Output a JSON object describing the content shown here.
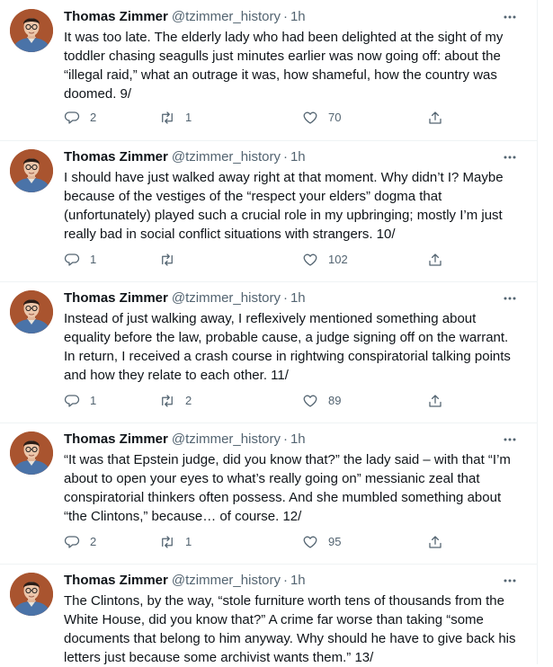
{
  "colors": {
    "text": "#0f1419",
    "secondary": "#536471",
    "divider": "#eff3f4",
    "avatar_bg": "#a9542f"
  },
  "icons": {
    "reply": "reply-icon",
    "retweet": "retweet-icon",
    "like": "like-icon",
    "share": "share-icon",
    "more": "more-options-icon"
  },
  "tweets": [
    {
      "name": "Thomas Zimmer",
      "handle": "@tzimmer_history",
      "separator": "·",
      "time": "1h",
      "text": "It was too late. The elderly lady who had been delighted at the sight of my toddler chasing seagulls just minutes earlier was now going off: about the “illegal raid,” what an outrage it was, how shameful, how the country was doomed. 9/",
      "replies": "2",
      "retweets": "1",
      "likes": "70"
    },
    {
      "name": "Thomas Zimmer",
      "handle": "@tzimmer_history",
      "separator": "·",
      "time": "1h",
      "text": "I should have just walked away right at that moment. Why didn’t I? Maybe because of the vestiges of the “respect your elders” dogma that (unfortunately) played such a crucial role in my upbringing; mostly I’m just really bad in social conflict situations with strangers. 10/",
      "replies": "1",
      "retweets": "",
      "likes": "102"
    },
    {
      "name": "Thomas Zimmer",
      "handle": "@tzimmer_history",
      "separator": "·",
      "time": "1h",
      "text": "Instead of just walking away, I reflexively mentioned something about equality before the law, probable cause, a judge signing off on the warrant. In return, I received a crash course in rightwing conspiratorial talking points and how they relate to each other. 11/",
      "replies": "1",
      "retweets": "2",
      "likes": "89"
    },
    {
      "name": "Thomas Zimmer",
      "handle": "@tzimmer_history",
      "separator": "·",
      "time": "1h",
      "text": "“It was that Epstein judge, did you know that?” the lady said – with that “I’m about to open your eyes to what’s really going on” messianic zeal that conspiratorial thinkers often possess. And she mumbled something about “the Clintons,” because… of course. 12/",
      "replies": "2",
      "retweets": "1",
      "likes": "95"
    },
    {
      "name": "Thomas Zimmer",
      "handle": "@tzimmer_history",
      "separator": "·",
      "time": "1h",
      "text": "The Clintons, by the way, “stole furniture worth tens of thousands from the White House, did you know that?” A crime far worse than taking “some documents that belong to him anyway. Why should he have to give back his letters just because some archivist wants them.” 13/"
    }
  ]
}
